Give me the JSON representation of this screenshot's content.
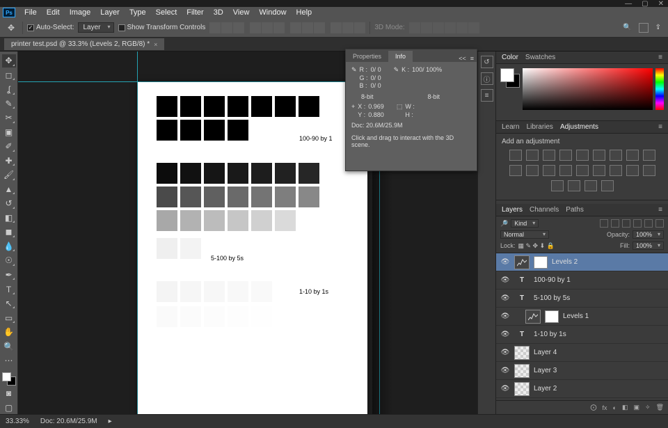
{
  "window": {
    "minimize": "—",
    "maximize": "▢",
    "close": "✕",
    "ps": "Ps"
  },
  "menu": [
    "File",
    "Edit",
    "Image",
    "Layer",
    "Type",
    "Select",
    "Filter",
    "3D",
    "View",
    "Window",
    "Help"
  ],
  "options": {
    "auto_select_label": "Auto-Select:",
    "auto_select_mode": "Layer",
    "show_transform": "Show Transform Controls",
    "threeD": "3D Mode:"
  },
  "doc_tab": {
    "title": "printer test.psd @ 33.3% (Levels 2, RGB/8) *",
    "close": "×"
  },
  "info_panel": {
    "tabs": [
      "Properties",
      "Info"
    ],
    "collapse": "<<",
    "r": "R :",
    "g": "G :",
    "b": "B :",
    "k": "K :",
    "rv": "0/   0",
    "gv": "0/   0",
    "bv": "0/   0",
    "kv": "100/  100%",
    "bit1": "8-bit",
    "bit2": "8-bit",
    "x": "X :",
    "y": "Y :",
    "xv": "0.969",
    "yv": "0.880",
    "w": "W :",
    "h": "H :",
    "doc": "Doc: 20.6M/25.9M",
    "hint": "Click and drag to interact with the 3D scene."
  },
  "canvas_labels": {
    "a": "100-90 by 1",
    "b": "5-100 by 5s",
    "c": "1-10 by 1s"
  },
  "color_panel": {
    "tabs": [
      "Color",
      "Swatches"
    ]
  },
  "adjustments": {
    "tabs": [
      "Learn",
      "Libraries",
      "Adjustments"
    ],
    "hint": "Add an adjustment"
  },
  "layers_panel": {
    "tabs": [
      "Layers",
      "Channels",
      "Paths"
    ],
    "kind": "Kind",
    "blend": "Normal",
    "opacity_label": "Opacity:",
    "opacity_val": "100%",
    "lock_label": "Lock:",
    "fill_label": "Fill:",
    "fill_val": "100%",
    "layers": [
      {
        "type": "adj",
        "name": "Levels 2",
        "sel": true,
        "mask": true
      },
      {
        "type": "text",
        "name": "100-90 by 1"
      },
      {
        "type": "text",
        "name": "5-100 by 5s"
      },
      {
        "type": "adj",
        "name": "Levels 1",
        "indent": true,
        "mask": true
      },
      {
        "type": "text",
        "name": "1-10 by 1s"
      },
      {
        "type": "pix",
        "name": "Layer 4",
        "checker": true
      },
      {
        "type": "pix",
        "name": "Layer 3",
        "checker": true
      },
      {
        "type": "pix",
        "name": "Layer 2",
        "checker": true
      }
    ],
    "footer_icons": [
      "⨀",
      "fx",
      "◐",
      "◧",
      "▣",
      "✧",
      "🗑"
    ]
  },
  "status": {
    "zoom": "33.33%",
    "doc": "Doc: 20.6M/25.9M"
  }
}
